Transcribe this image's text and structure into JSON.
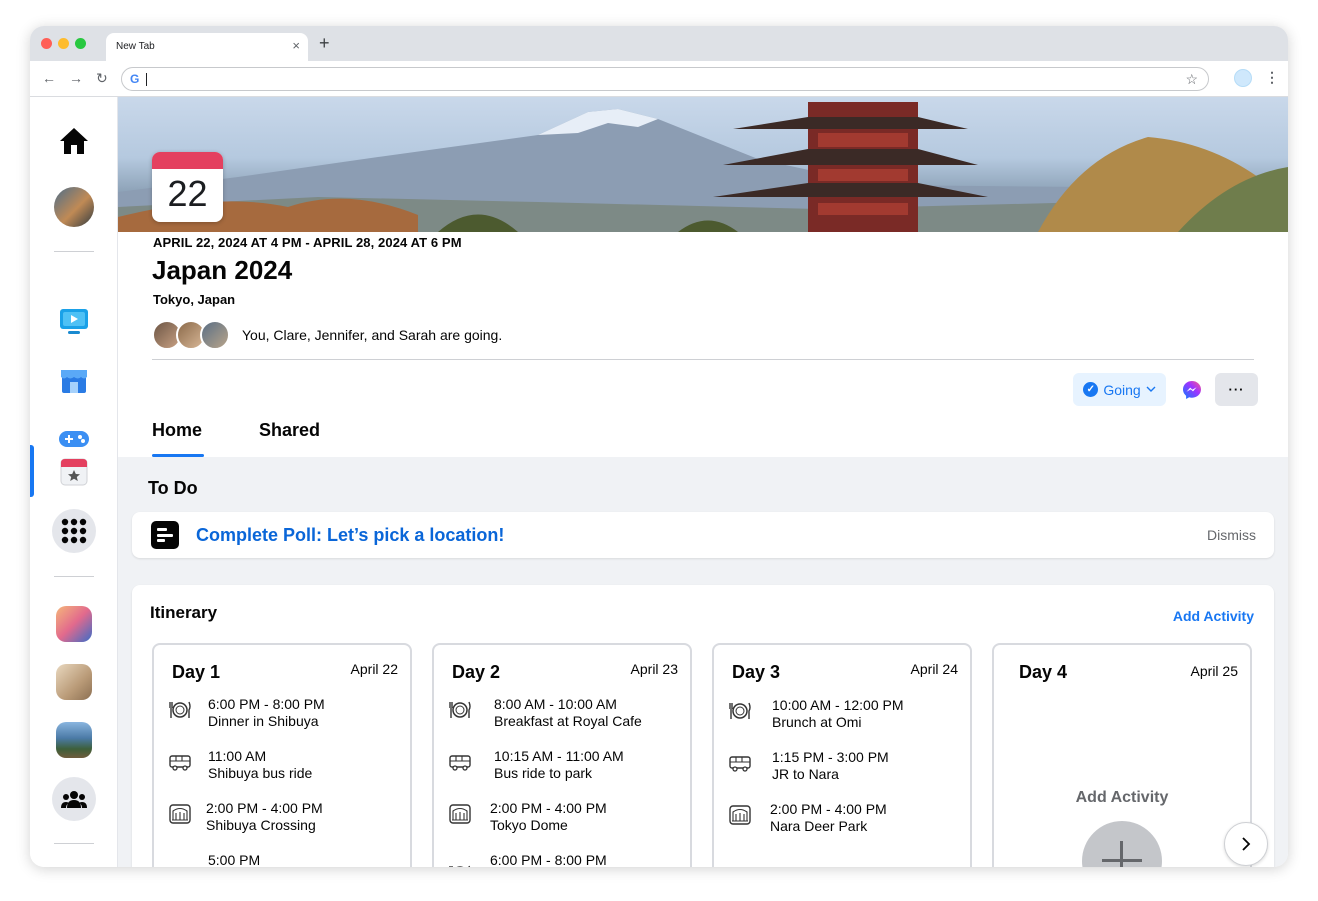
{
  "browser": {
    "tab_title": "New Tab",
    "tab_close": "×",
    "new_tab": "+",
    "omnibox_value": "",
    "back": "←",
    "forward": "→",
    "reload": "↻",
    "bookmark": "☆",
    "menu": "⋮",
    "google_letter": "G"
  },
  "event": {
    "calendar_day": "22",
    "date_range": "APRIL 22, 2024 AT 4 PM - APRIL 28, 2024 AT 6 PM",
    "title": "Japan 2024",
    "location": "Tokyo, Japan",
    "going_text": "You, Clare, Jennifer, and Sarah are going.",
    "going_button": "Going",
    "more_button": "···"
  },
  "tabs": {
    "home": "Home",
    "shared": "Shared"
  },
  "todo": {
    "heading": "To Do",
    "item": "Complete Poll: Let’s pick a location!",
    "dismiss": "Dismiss"
  },
  "itinerary": {
    "title": "Itinerary",
    "add_activity": "Add Activity",
    "days": [
      {
        "title": "Day 1",
        "date": "April 22",
        "activities": [
          {
            "time": "6:00 PM - 8:00 PM",
            "name": "Dinner in Shibuya",
            "icon": "dining-icon"
          },
          {
            "time": "11:00 AM",
            "name": "Shibuya bus ride",
            "icon": "bus-icon"
          },
          {
            "time": "2:00 PM - 4:00 PM",
            "name": "Shibuya Crossing",
            "icon": "landmark-icon"
          },
          {
            "time": "5:00 PM",
            "name": "",
            "icon": "bus-icon"
          }
        ]
      },
      {
        "title": "Day 2",
        "date": "April 23",
        "activities": [
          {
            "time": "8:00 AM - 10:00 AM",
            "name": "Breakfast at Royal Cafe",
            "icon": "dining-icon"
          },
          {
            "time": "10:15 AM - 11:00 AM",
            "name": "Bus ride to park",
            "icon": "bus-icon"
          },
          {
            "time": "2:00 PM - 4:00 PM",
            "name": "Tokyo Dome",
            "icon": "landmark-icon"
          },
          {
            "time": "6:00 PM - 8:00 PM",
            "name": "",
            "icon": "dining-icon"
          }
        ]
      },
      {
        "title": "Day 3",
        "date": "April 24",
        "activities": [
          {
            "time": "10:00 AM - 12:00 PM",
            "name": "Brunch at Omi",
            "icon": "dining-icon"
          },
          {
            "time": "1:15 PM - 3:00 PM",
            "name": "JR to Nara",
            "icon": "bus-icon"
          },
          {
            "time": "2:00 PM - 4:00 PM",
            "name": "Nara Deer Park",
            "icon": "landmark-icon"
          }
        ]
      },
      {
        "title": "Day 4",
        "date": "April 25",
        "add_label": "Add Activity"
      }
    ]
  },
  "colors": {
    "accent": "#1877f2",
    "link": "#0a66d8",
    "calendar_red": "#e4405f"
  }
}
